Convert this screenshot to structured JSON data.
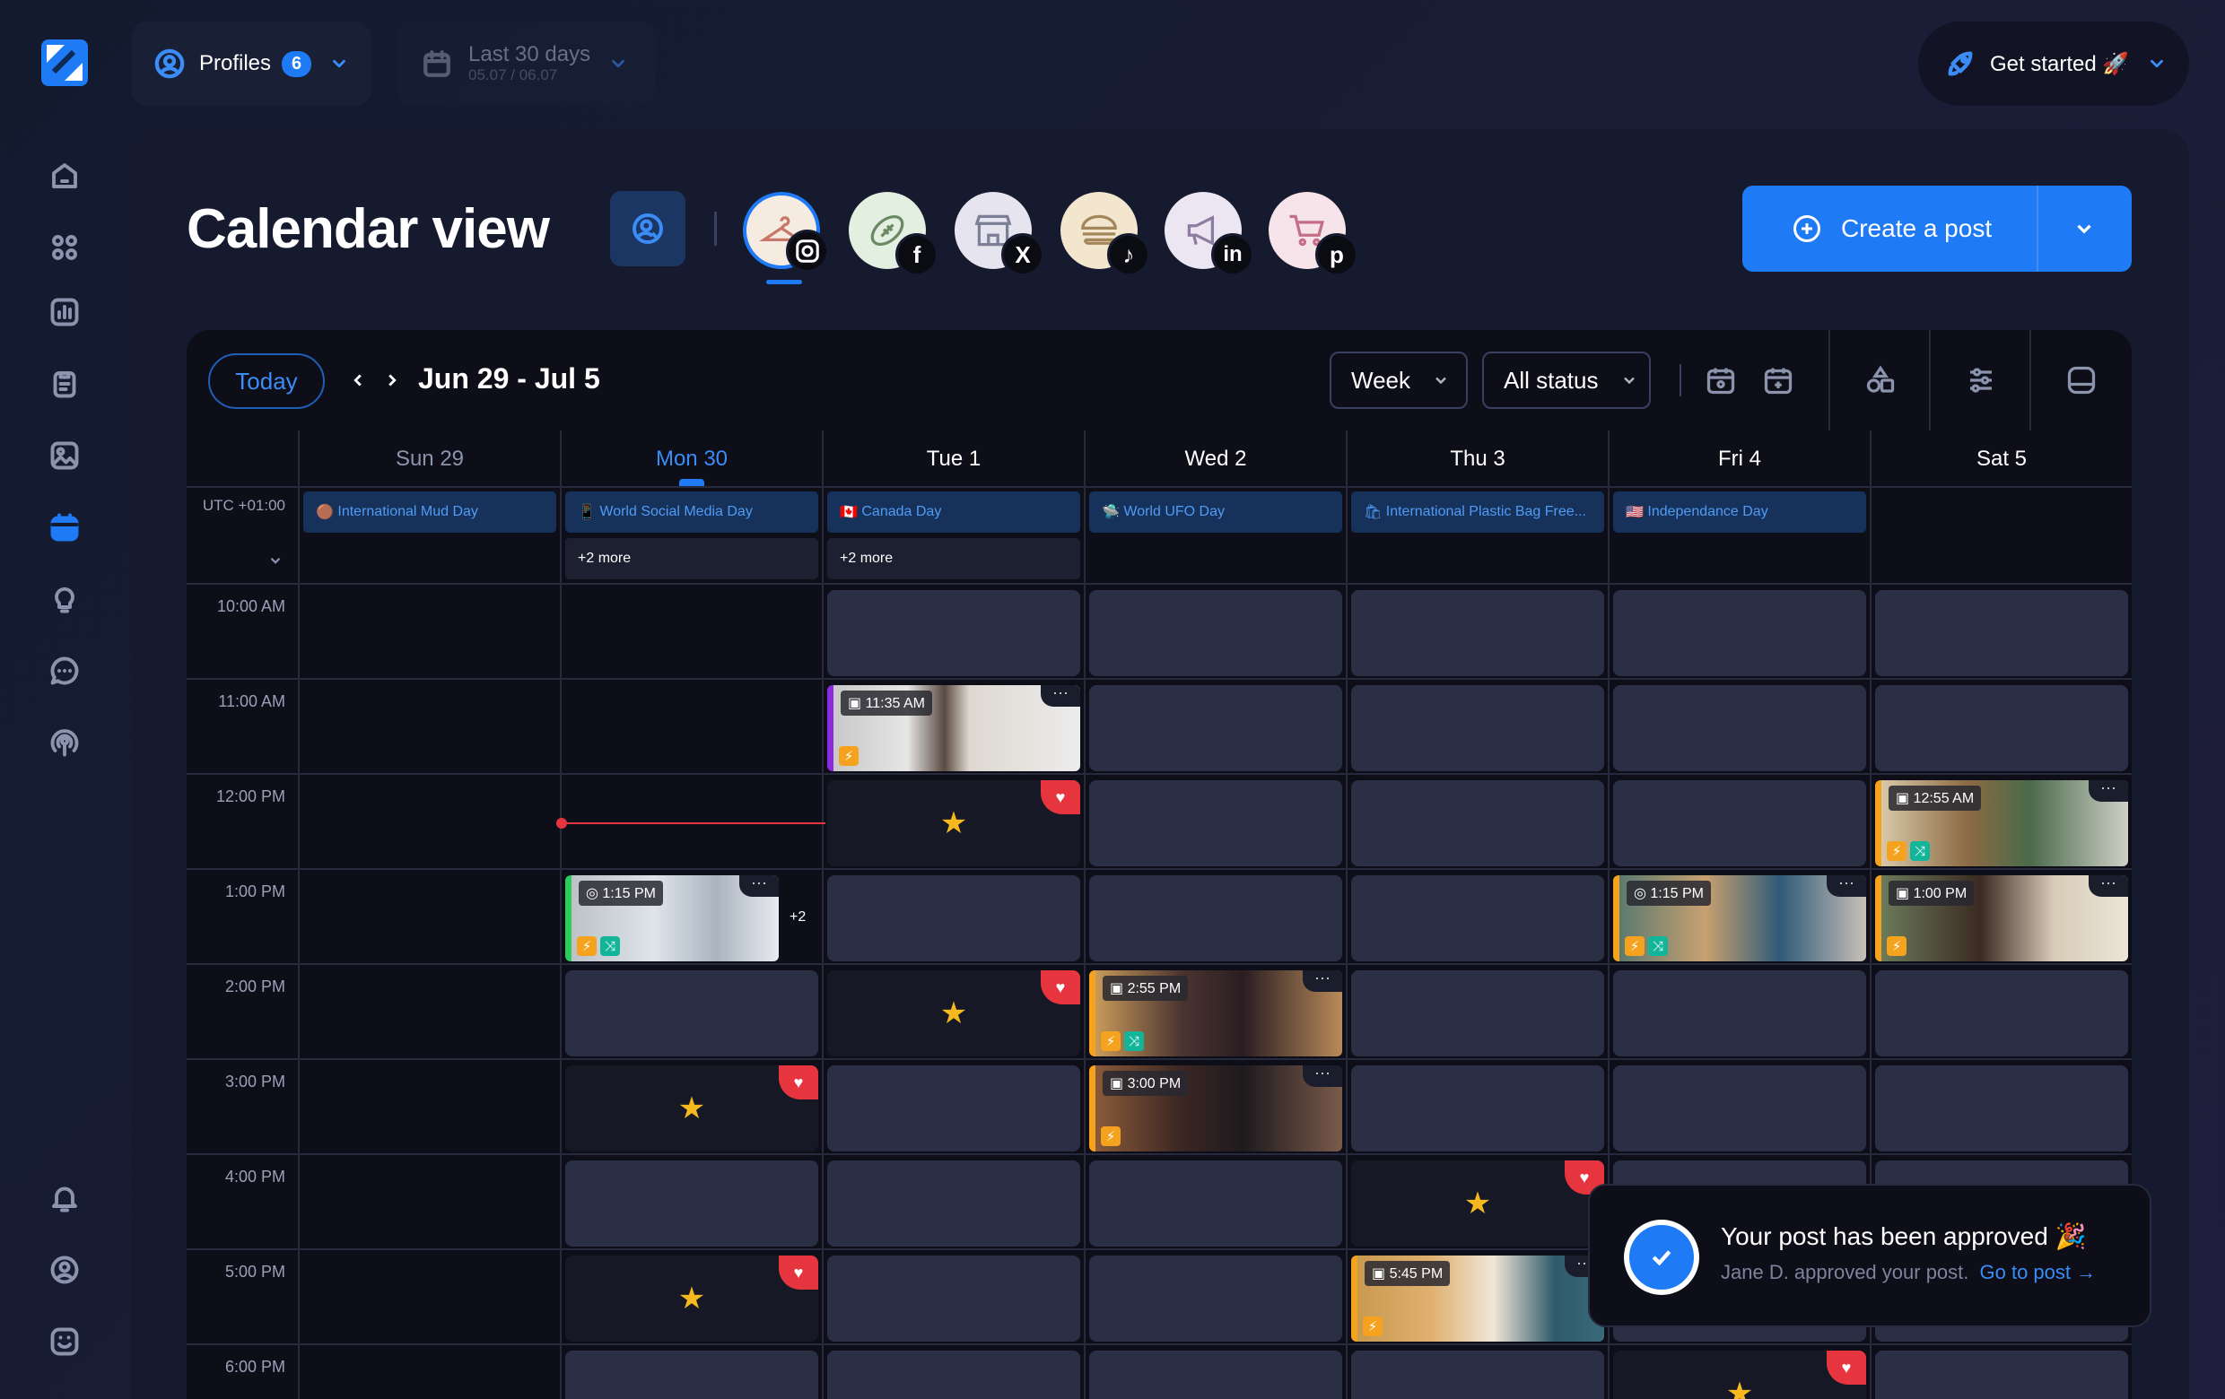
{
  "topbar": {
    "profiles_label": "Profiles",
    "profiles_count": "6",
    "date_range_label": "Last 30 days",
    "date_range_sub": "05.07 / 06.07",
    "get_started_label": "Get started 🚀"
  },
  "header": {
    "title": "Calendar view",
    "create_post_label": "Create a post"
  },
  "profiles": [
    {
      "name": "Clothing hanger",
      "social": "instagram"
    },
    {
      "name": "Football",
      "social": "facebook"
    },
    {
      "name": "Store",
      "social": "x"
    },
    {
      "name": "Burger",
      "social": "tiktok"
    },
    {
      "name": "Megaphone",
      "social": "linkedin"
    },
    {
      "name": "Shopping cart",
      "social": "pinterest"
    }
  ],
  "calendar": {
    "today_label": "Today",
    "range_label": "Jun 29 - Jul 5",
    "view_select": "Week",
    "status_select": "All status",
    "timezone": "UTC +01:00",
    "days": [
      "Sun 29",
      "Mon 30",
      "Tue 1",
      "Wed 2",
      "Thu 3",
      "Fri 4",
      "Sat 5"
    ],
    "holidays": [
      "International Mud Day",
      "World Social Media Day",
      "Canada Day",
      "World UFO Day",
      "International Plastic Bag Free...",
      "Independance Day"
    ],
    "more_mon": "+2 more",
    "more_tue": "+2 more",
    "times": [
      "10:00 AM",
      "11:00 AM",
      "12:00 PM",
      "1:00 PM",
      "2:00 PM",
      "3:00 PM",
      "4:00 PM",
      "5:00 PM",
      "6:00 PM"
    ],
    "post_times": {
      "tue_1135": "11:35 AM",
      "sat_1255": "12:55 AM",
      "mon_115": "1:15 PM",
      "mon_more": "+2",
      "fri_115": "1:15 PM",
      "sat_100": "1:00 PM",
      "wed_255": "2:55 PM",
      "wed_300": "3:00 PM",
      "thu_545": "5:45 PM"
    }
  },
  "toast": {
    "title": "Your post has been approved 🎉",
    "message": "Jane D. approved your post.",
    "link": "Go to post"
  },
  "colors": {
    "accent": "#1e7bf5",
    "heart": "#e6353f",
    "star": "#f5b81e"
  }
}
